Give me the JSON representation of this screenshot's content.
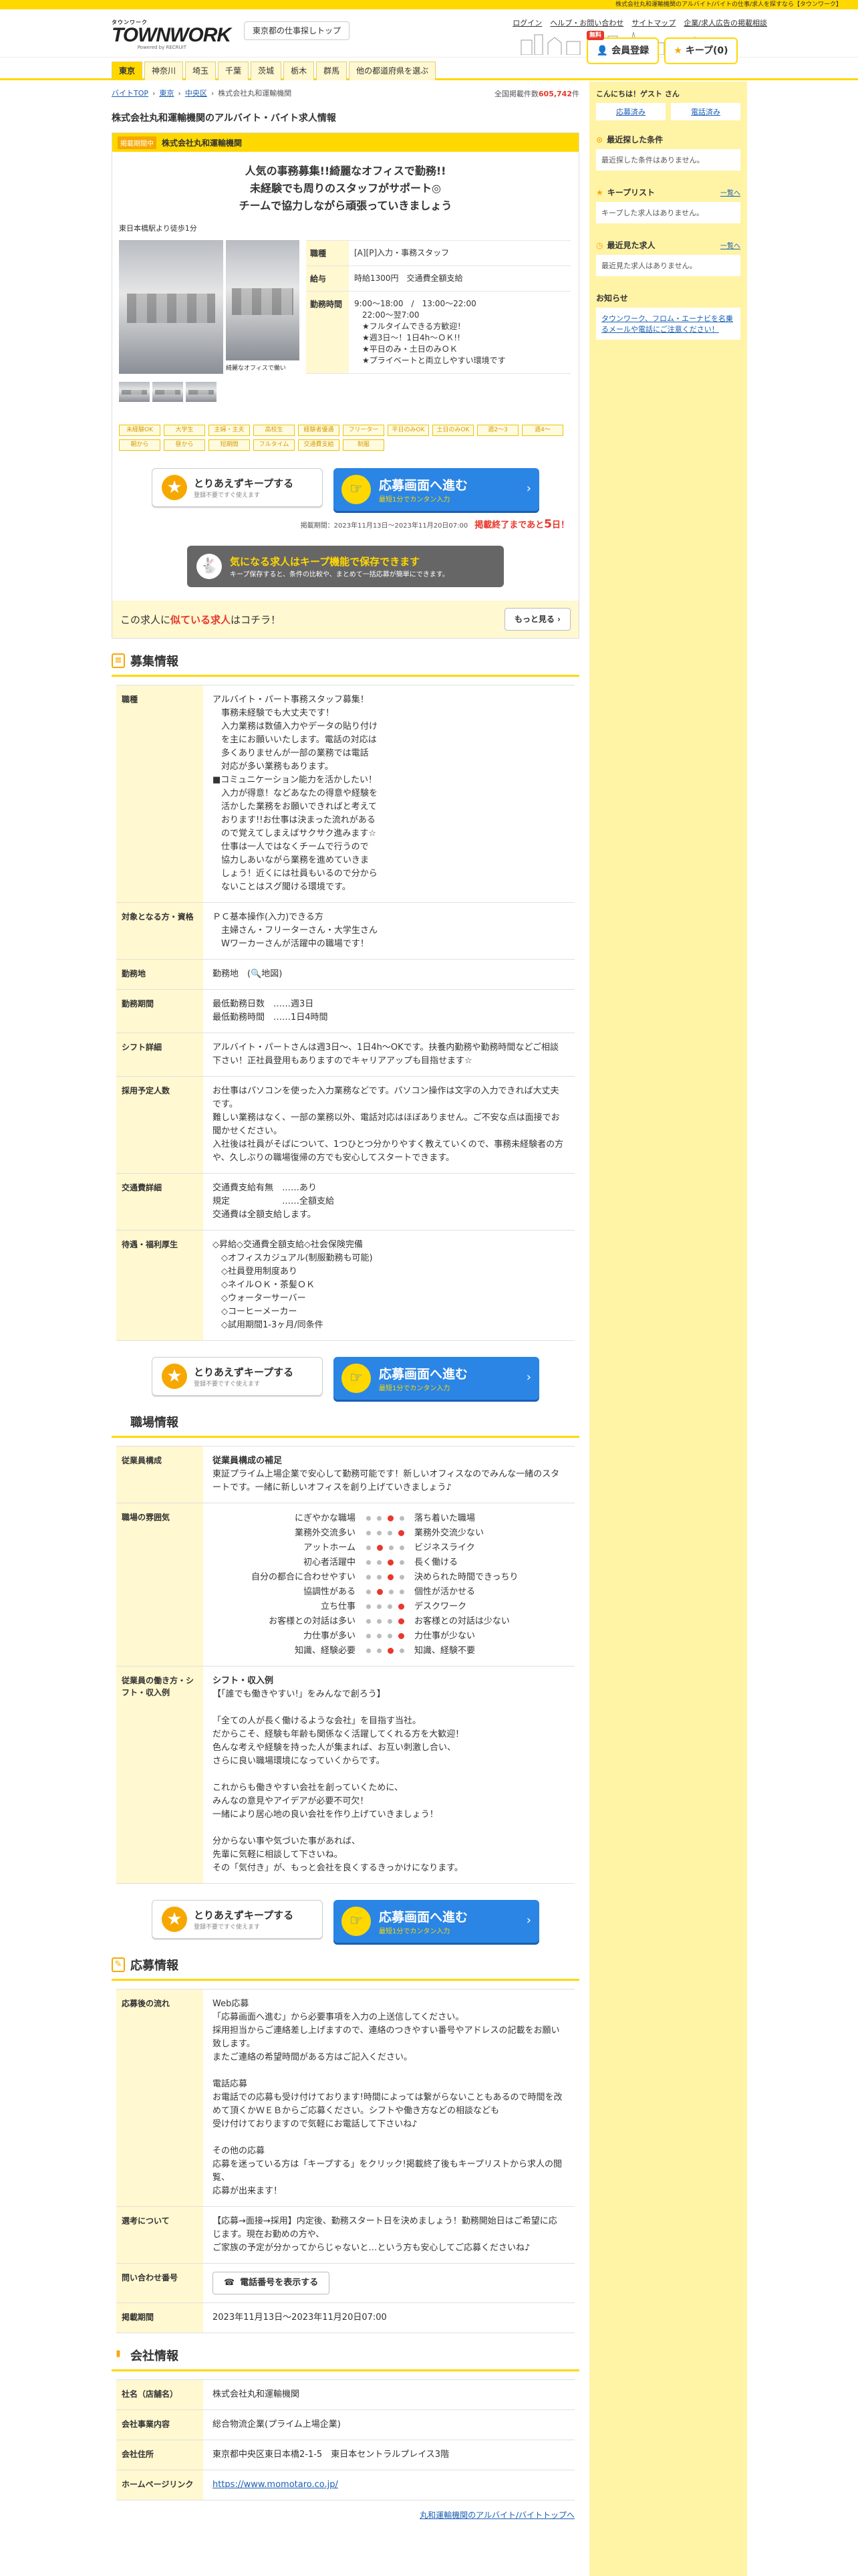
{
  "topbar": {
    "text": "株式会社丸和運輸機関のアルバイト/バイトの仕事/求人を探すなら【タウンワーク】"
  },
  "header": {
    "logo_small": "タウンワーク",
    "logo": "TOWNWORK",
    "logo_sub": "Powered by RECRUIT",
    "area_button": "東京都の仕事探しトップ",
    "links": [
      "ログイン",
      "ヘルプ・お問い合わせ",
      "サイトマップ",
      "企業/求人広告の掲載相談"
    ],
    "register_badge": "無料",
    "register": "会員登録",
    "keep": "キープ",
    "keep_count": "(0)"
  },
  "nav": {
    "tabs": [
      "東京",
      "神奈川",
      "埼玉",
      "千葉",
      "茨城",
      "栃木",
      "群馬",
      "他の都道府県を選ぶ"
    ]
  },
  "breadcrumb": [
    "バイトTOP",
    "東京",
    "中央区",
    "株式会社丸和運輸機関"
  ],
  "total": {
    "label": "全国掲載件数",
    "value": "605,742",
    "unit": "件"
  },
  "job": {
    "page_title": "株式会社丸和運輸機関のアルバイト・バイト求人情報",
    "badge": "掲載期間中",
    "company": "株式会社丸和運輸機関",
    "catch": [
      "人気の事務募集!!綺麗なオフィスで勤務!!",
      "未経験でも周りのスタッフがサポート◎",
      "チームで協力しながら頑張っていきましょう"
    ],
    "station": "東日本橋駅より徒歩1分",
    "photo_caption": "綺麗なオフィスで働い",
    "info": [
      {
        "label": "職種",
        "value": "[A][P]入力・事務スタッフ"
      },
      {
        "label": "給与",
        "value": "時給1300円　交通費全額支給"
      },
      {
        "label": "勤務時間",
        "value": "9:00〜18:00　/　13:00〜22:00\n　22:00〜翌7:00\n　★フルタイムできる方歓迎！\n　★週3日〜！1日4h〜ＯＫ!!\n　★平日のみ・土日のみＯＫ\n　★プライベートと両立しやすい環境です"
      }
    ],
    "tags": [
      "未経験OK",
      "大学生",
      "主婦・主夫",
      "高校生",
      "経験者優遇",
      "フリーター",
      "平日のみOK",
      "土日のみOK",
      "週2〜3",
      "週4〜",
      "朝から",
      "昼から",
      "短期間",
      "フルタイム",
      "交通費支給",
      "制服"
    ]
  },
  "cta": {
    "keep_main": "とりあえずキープする",
    "keep_sub": "登録不要ですぐ使えます",
    "apply_main": "応募画面へ進む",
    "apply_sub": "最短1分でカンタン入力"
  },
  "period": {
    "text": "掲載期間：2023年11月13日〜2023年11月20日07:00",
    "deadline_pre": "掲載終了まであと",
    "deadline_days": "5",
    "deadline_post": "日！"
  },
  "keep_banner": {
    "main": "気になる求人はキープ機能で保存できます",
    "sub": "キープ保存すると、条件の比較や、まとめて一括応募が簡単にできます。"
  },
  "similar": {
    "pre": "この求人に",
    "emph": "似ている求人",
    "post": "はコチラ！",
    "button": "もっと見る"
  },
  "recruit": {
    "heading": "募集情報",
    "rows": [
      {
        "label": "職種",
        "value": "アルバイト・パート事務スタッフ募集！\n　事務未経験でも大丈夫です！\n　入力業務は数値入力やデータの貼り付け\n　を主にお願いいたします。電話の対応は\n　多くありませんが一部の業務では電話\n　対応が多い業務もあります。\n■コミュニケーション能力を活かしたい！\n　入力が得意！などあなたの得意や経験を\n　活かした業務をお願いできればと考えて\n　おります!!お仕事は決まった流れがある\n　ので覚えてしまえばサクサク進みます☆\n　仕事は一人ではなくチームで行うので\n　協力しあいながら業務を進めていきま\n　しょう！近くには社員もいるので分から\n　ないことはスグ聞ける環境です。"
      },
      {
        "label": "対象となる方・資格",
        "value": "ＰＣ基本操作(入力)できる方\n　主婦さん・フリーターさん・大学生さん\n　Wワーカーさんが活躍中の職場です！"
      },
      {
        "label": "勤務地",
        "value": "勤務地　(🔍地図)"
      },
      {
        "label": "勤務期間",
        "value": "最低勤務日数　……週3日\n最低勤務時間　……1日4時間"
      },
      {
        "label": "シフト詳細",
        "value": "アルバイト・パートさんは週3日〜、1日4h〜OKです。扶養内勤務や勤務時間などご相談下さい！正社員登用もありますのでキャリアアップも目指せます☆"
      },
      {
        "label": "採用予定人数",
        "value": "お仕事はパソコンを使った入力業務などです。パソコン操作は文字の入力できれば大丈夫です。\n難しい業務はなく、一部の業務以外、電話対応はほぼありません。ご不安な点は面接でお聞かせください。\n入社後は社員がそばについて、1つひとつ分かりやすく教えていくので、事務未経験者の方や、久しぶりの職場復帰の方でも安心してスタートできます。"
      },
      {
        "label": "交通費詳細",
        "value": "交通費支給有無　……あり\n規定　　　　　　……全額支給\n交通費は全額支給します。"
      },
      {
        "label": "待遇・福利厚生",
        "value": "◇昇給◇交通費全額支給◇社会保険完備\n　◇オフィスカジュアル(制服勤務も可能)\n　◇社員登用制度あり\n　◇ネイルＯＫ・茶髪ＯＫ\n　◇ウォーターサーバー\n　◇コーヒーメーカー\n　◇試用期間1-3ヶ月/同条件"
      }
    ]
  },
  "workplace": {
    "heading": "職場情報",
    "staff_label": "従業員構成",
    "staff_title": "従業員構成の補足",
    "staff_text": "東証プライム上場企業で安心して勤務可能です！新しいオフィスなのでみんな一緒のスタートです。一緒に新しいオフィスを創り上げていきましょう♪",
    "atmo_label": "職場の雰囲気",
    "atmo": [
      {
        "l": "にぎやかな職場",
        "r": "落ち着いた職場",
        "pos": 2
      },
      {
        "l": "業務外交流多い",
        "r": "業務外交流少ない",
        "pos": 3
      },
      {
        "l": "アットホーム",
        "r": "ビジネスライク",
        "pos": 1
      },
      {
        "l": "初心者活躍中",
        "r": "長く働ける",
        "pos": 2
      },
      {
        "l": "自分の都合に合わせやすい",
        "r": "決められた時間できっちり",
        "pos": 2
      },
      {
        "l": "協調性がある",
        "r": "個性が活かせる",
        "pos": 1
      },
      {
        "l": "立ち仕事",
        "r": "デスクワーク",
        "pos": 3
      },
      {
        "l": "お客様との対話は多い",
        "r": "お客様との対話は少ない",
        "pos": 3
      },
      {
        "l": "力仕事が多い",
        "r": "力仕事が少ない",
        "pos": 3
      },
      {
        "l": "知識、経験必要",
        "r": "知識、経験不要",
        "pos": 2
      }
    ],
    "shift_label": "従業員の働き方・シフト・収入例",
    "shift_title": "シフト・収入例",
    "shift_text": "【「誰でも働きやすい!」をみんなで創ろう】\n\n「全ての人が長く働けるような会社」を目指す当社。\nだからこそ、経験も年齢も関係なく活躍してくれる方を大歓迎！\n色んな考えや経験を持った人が集まれば、お互い刺激し合い、\nさらに良い職場環境になっていくからです。\n\nこれからも働きやすい会社を創っていくために、\nみんなの意見やアイデアが必要不可欠！\n一緒により居心地の良い会社を作り上げていきましょう！\n\n分からない事や気づいた事があれば、\n先輩に気軽に相談して下さいね。\nその「気付き」が、もっと会社を良くするきっかけになります。"
  },
  "apply": {
    "heading": "応募情報",
    "flow_label": "応募後の流れ",
    "flow": "Web応募\n「応募画面へ進む」から必要事項を入力の上送信してください。\n採用担当からご連絡差し上げますので、連絡のつきやすい番号やアドレスの記載をお願い致します。\nまたご連絡の希望時間がある方はご記入ください。\n\n電話応募\nお電話での応募も受け付けております!時間によっては繋がらないこともあるので時間を改めて頂くかＷＥＢからご応募ください。シフトや働き方などの相談なども\n受け付けておりますので気軽にお電話して下さいね♪\n\nその他の応募\n応募を迷っている方は「キープする」をクリック!掲載終了後もキープリストから求人の閲覧、\n応募が出来ます！",
    "contact_label": "選考について",
    "contact": "【応募→面接→採用】内定後、勤務スタート日を決めましょう！勤務開始日はご希望に応じます。現在お勤めの方や、\nご家族の予定が分かってからじゃないと…という方も安心してご応募くださいね♪",
    "phone_label": "問い合わせ番号",
    "phone_button": "電話番号を表示する",
    "period_label": "掲載期間",
    "period": "2023年11月13日〜2023年11月20日07:00"
  },
  "company": {
    "heading": "会社情報",
    "rows": [
      {
        "label": "社名（店舗名）",
        "value": "株式会社丸和運輸機関"
      },
      {
        "label": "会社事業内容",
        "value": "総合物流企業(プライム上場企業)"
      },
      {
        "label": "会社住所",
        "value": "東京都中央区東日本橋2-1-5　東日本セントラルプレイス3階"
      },
      {
        "label": "ホームページリンク",
        "value": "https://www.momotaro.co.jp/"
      }
    ],
    "footer_link": "丸和運輸機関のアルバイト/バイトトップへ"
  },
  "sidebar": {
    "greeting": "こんにちは！ゲスト さん",
    "link1": "応募済み",
    "link2": "電話済み",
    "recent_search_title": "最近探した条件",
    "recent_search_text": "最近探した条件はありません。",
    "keep_title": "キープリスト",
    "keep_more": "一覧へ",
    "keep_text": "キープした求人はありません。",
    "viewed_title": "最近見た求人",
    "viewed_more": "一覧へ",
    "viewed_text": "最近見た求人はありません。",
    "notice_title": "お知らせ",
    "notice_link": "タウンワーク、フロム・エーナビを名乗るメールや電話にご注意ください！"
  }
}
